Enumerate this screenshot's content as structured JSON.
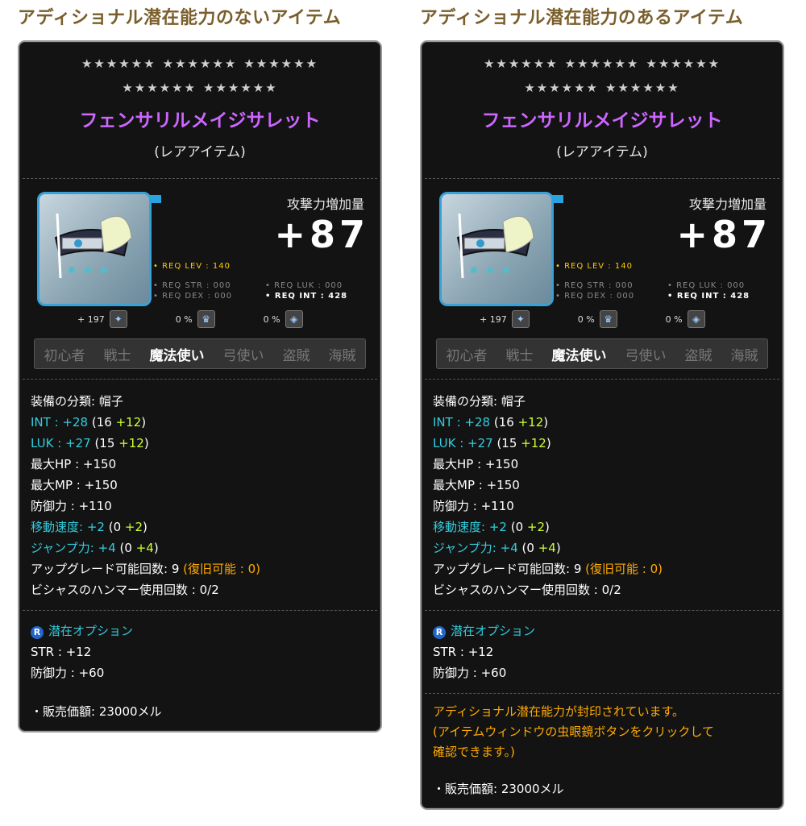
{
  "captions": {
    "left": "アディショナル潜在能力のないアイテム",
    "right": "アディショナル潜在能力のあるアイテム"
  },
  "tooltip": {
    "stars_row1": [
      "★★★★★★",
      "★★★★★★",
      "★★★★★★"
    ],
    "stars_row2": [
      "★★★★★★",
      "★★★★★★"
    ],
    "item_name": "フェンサリルメイジサレット",
    "rarity": "(レアアイテム)",
    "attack_label": "攻撃力増加量",
    "attack_value": "+87",
    "req_lev": "• REQ LEV : 140",
    "req_str": "• REQ STR : 000",
    "req_luk": "• REQ LUK : 000",
    "req_dex": "• REQ DEX : 000",
    "req_int": "• REQ INT : 428",
    "small_stat1": "+ 197",
    "small_stat2": "0 %",
    "small_stat3": "0 %",
    "jobs": [
      "初心者",
      "戦士",
      "魔法使い",
      "弓使い",
      "盗賊",
      "海賊"
    ],
    "active_job_index": 2,
    "equip_type": "装備の分類: 帽子",
    "int_label": "INT : +28",
    "int_base": "(16",
    "int_bonus": "+12",
    "luk_label": "LUK : +27",
    "luk_base": "(15",
    "luk_bonus": "+12",
    "max_hp": "最大HP : +150",
    "max_mp": "最大MP : +150",
    "defense": "防御力 : +110",
    "speed_label": "移動速度: +2",
    "speed_base": "(0",
    "speed_bonus": "+2",
    "jump_label": "ジャンプ力: +4",
    "jump_base": "(0",
    "jump_bonus": "+4",
    "upgrade": "アップグレード可能回数: 9",
    "upgrade_restore": "(復旧可能 : 0)",
    "hammer": "ビシャスのハンマー使用回数 : 0/2",
    "potential_badge": "R",
    "potential_title": "潜在オプション",
    "pot_str": "STR : +12",
    "pot_def": "防御力 : +60",
    "sealed_line1": "アディショナル潜在能力が封印されています。",
    "sealed_line2": "(アイテムウィンドウの虫眼鏡ボタンをクリックして",
    "sealed_line3": "確認できます。)",
    "sale_price": "・販売価額: 23000メル"
  },
  "colors": {
    "name": "#cc66ff",
    "stat_cyan": "#33ccdd",
    "bonus_green": "#ccff33",
    "notice_orange": "#ffaa00"
  }
}
